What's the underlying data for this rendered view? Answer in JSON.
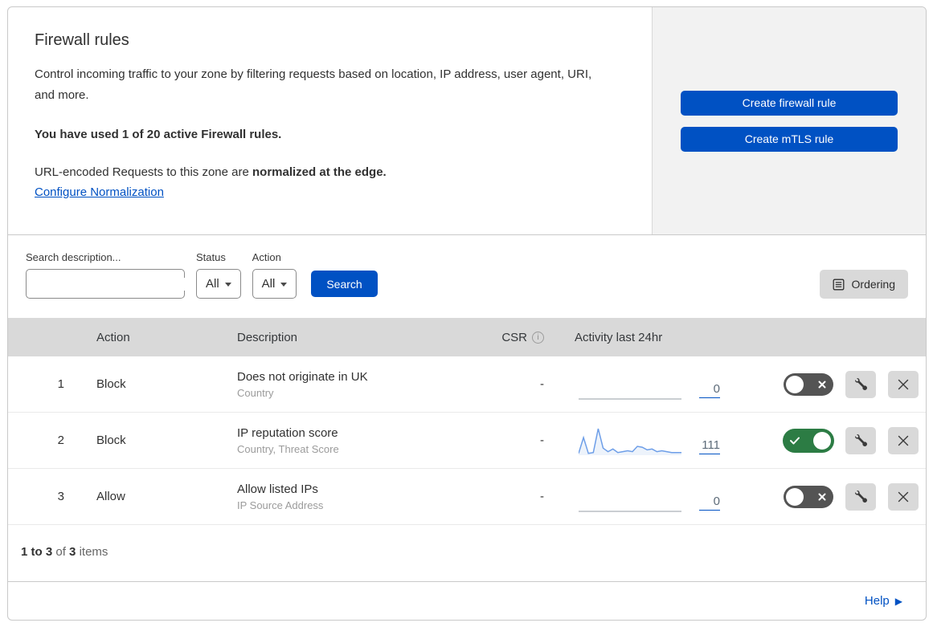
{
  "colors": {
    "accent_blue": "#0051c3",
    "toggle_on_green": "#2c7c44",
    "toggle_off_gray": "#545454",
    "panel_gray": "#f2f2f2",
    "table_header_gray": "#d9d9d9",
    "sparkline_blue": "#6d9ee8"
  },
  "header": {
    "title": "Firewall rules",
    "description": "Control incoming traffic to your zone by filtering requests based on location, IP address, user agent, URI, and more.",
    "usage_notice": "You have used 1 of 20 active Firewall rules.",
    "normalization_prefix": "URL-encoded Requests to this zone are ",
    "normalization_bold": "normalized at the edge.",
    "normalization_link": "Configure Normalization",
    "create_firewall_rule_label": "Create firewall rule",
    "create_mtls_rule_label": "Create mTLS rule"
  },
  "filters": {
    "search_label": "Search description...",
    "status_label": "Status",
    "status_value": "All",
    "action_label": "Action",
    "action_value": "All",
    "search_button_label": "Search",
    "ordering_button_label": "Ordering"
  },
  "table": {
    "headers": {
      "action": "Action",
      "description": "Description",
      "csr": "CSR",
      "activity": "Activity last 24hr"
    },
    "rows": [
      {
        "num": "1",
        "action": "Block",
        "title": "Does not originate in UK",
        "subtitle": "Country",
        "csr": "-",
        "count": "0",
        "enabled": false
      },
      {
        "num": "2",
        "action": "Block",
        "title": "IP reputation score",
        "subtitle": "Country, Threat Score",
        "csr": "-",
        "count": "111",
        "enabled": true
      },
      {
        "num": "3",
        "action": "Allow",
        "title": "Allow listed IPs",
        "subtitle": "IP Source Address",
        "csr": "-",
        "count": "0",
        "enabled": false
      }
    ]
  },
  "footer": {
    "range": "1 to 3",
    "of": "of",
    "total": "3",
    "items": "items"
  },
  "help": {
    "label": "Help",
    "arrow": "▶"
  },
  "chart_data": [
    {
      "type": "area",
      "description": "Activity last 24hr sparkline - rule 1 (Does not originate in UK)",
      "values": [
        0,
        0,
        0,
        0,
        0,
        0,
        0,
        0,
        0,
        0,
        0,
        0,
        0,
        0,
        0,
        0,
        0,
        0,
        0,
        0,
        0,
        0
      ],
      "total": 0,
      "line_color": "#b9bec4",
      "fill_color": "none"
    },
    {
      "type": "area",
      "description": "Activity last 24hr sparkline - rule 2 (IP reputation score)",
      "values": [
        2,
        20,
        2,
        3,
        30,
        8,
        4,
        7,
        3,
        4,
        5,
        4,
        10,
        9,
        6,
        7,
        4,
        5,
        4,
        3,
        3,
        3
      ],
      "total": 111,
      "ylim": [
        0,
        30
      ],
      "line_color": "#6d9ee8",
      "fill_color": "#edf3fb"
    },
    {
      "type": "area",
      "description": "Activity last 24hr sparkline - rule 3 (Allow listed IPs)",
      "values": [
        0,
        0,
        0,
        0,
        0,
        0,
        0,
        0,
        0,
        0,
        0,
        0,
        0,
        0,
        0,
        0,
        0,
        0,
        0,
        0,
        0,
        0
      ],
      "total": 0,
      "line_color": "#b9bec4",
      "fill_color": "none"
    }
  ]
}
